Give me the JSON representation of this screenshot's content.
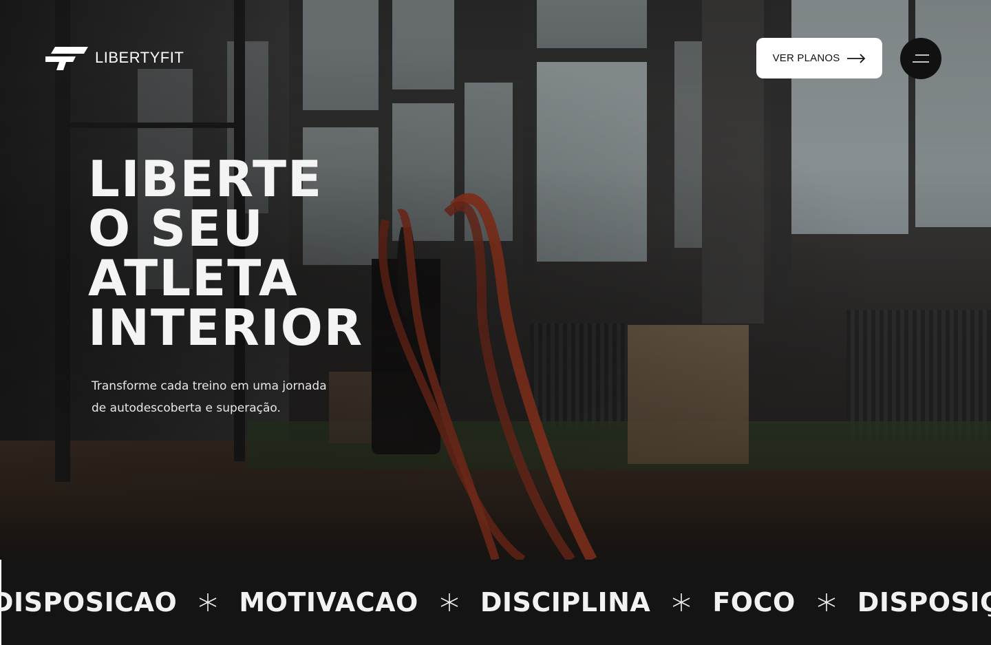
{
  "brand": {
    "name": "LIBERTYFIT",
    "logo_icon": "libertyfit-logo-icon"
  },
  "header": {
    "cta_label": "VER PLANOS",
    "cta_icon": "arrow-right-icon",
    "menu_icon": "hamburger-menu-icon"
  },
  "hero": {
    "headline_lines": [
      "LIBERTE",
      "O SEU",
      "ATLETA",
      "INTERIOR"
    ],
    "subtitle_line1": "Transforme cada treino em uma jornada",
    "subtitle_line2": "de autodescoberta e superação."
  },
  "marquee": {
    "items": [
      "DISPOSICAO",
      "MOTIVACAO",
      "DISCIPLINA",
      "FOCO",
      "DISPOSIÇÃO"
    ],
    "separator_icon": "asterisk-star-icon"
  },
  "colors": {
    "background": "#141414",
    "text": "#f2f2f2",
    "cta_background": "#ffffff",
    "menu_background": "#111111"
  }
}
